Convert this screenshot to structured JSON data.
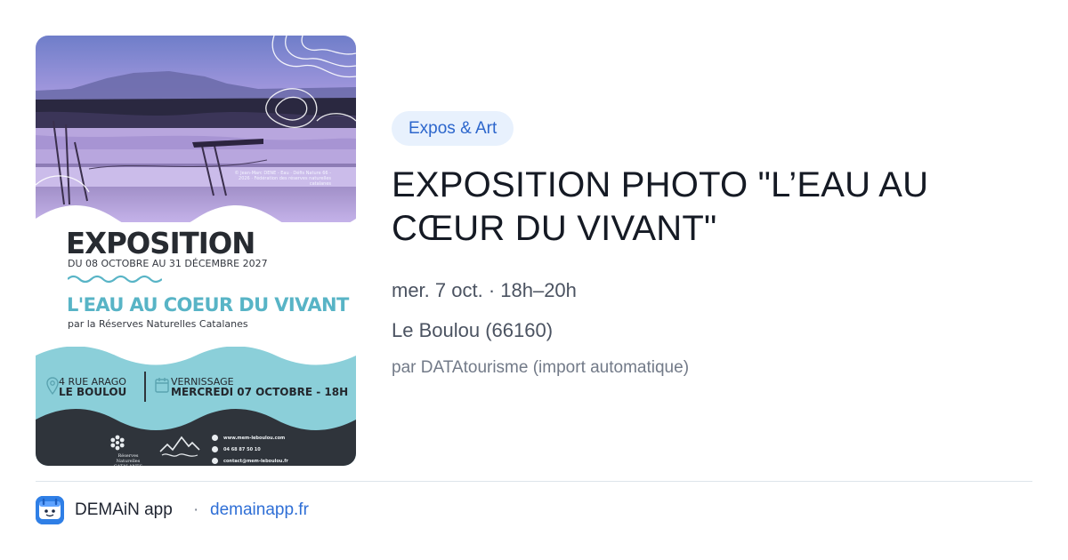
{
  "poster": {
    "credit": "© Jean-Marc DENE - Eau · Défis Nature 66 - 2026 · Fédération des réserves naturelles catalanes",
    "title": "EXPOSITION",
    "dates": "DU 08 OCTOBRE AU 31 DÉCEMBRE 2027",
    "subtitle": "L'EAU AU COEUR DU VIVANT",
    "byline": "par la Réserves Naturelles Catalanes",
    "address_line1": "4 RUE ARAGO",
    "address_line2": "LE BOULOU",
    "vernissage_line1": "VERNISSAGE",
    "vernissage_line2": "MERCREDI 07 OCTOBRE - 18H",
    "logo_text": "Réserves Naturelles CATALANES",
    "contacts": [
      "www.mem-leboulou.com",
      "04 68 87 50 10",
      "contact@mem-leboulou.fr"
    ],
    "colors": {
      "teal": "#8bcfd9",
      "dark": "#2f343b",
      "accent_text": "#58b4c6",
      "sky": "#a99be0"
    }
  },
  "event": {
    "category": "Expos & Art",
    "title": "EXPOSITION PHOTO \"L’EAU AU CŒUR DU VIVANT\"",
    "when": "mer. 7 oct. · 18h–20h",
    "where": "Le Boulou (66160)",
    "source": "par DATAtourisme (import automatique)"
  },
  "footer": {
    "app_icon": "demain-app-icon",
    "app_name": "DEMAiN app",
    "separator": "·",
    "link": "demainapp.fr"
  },
  "colors": {
    "tag_bg": "#e8f1fd",
    "tag_text": "#2c66cc",
    "link": "#2f6fd6",
    "divider": "#dde5ea"
  }
}
